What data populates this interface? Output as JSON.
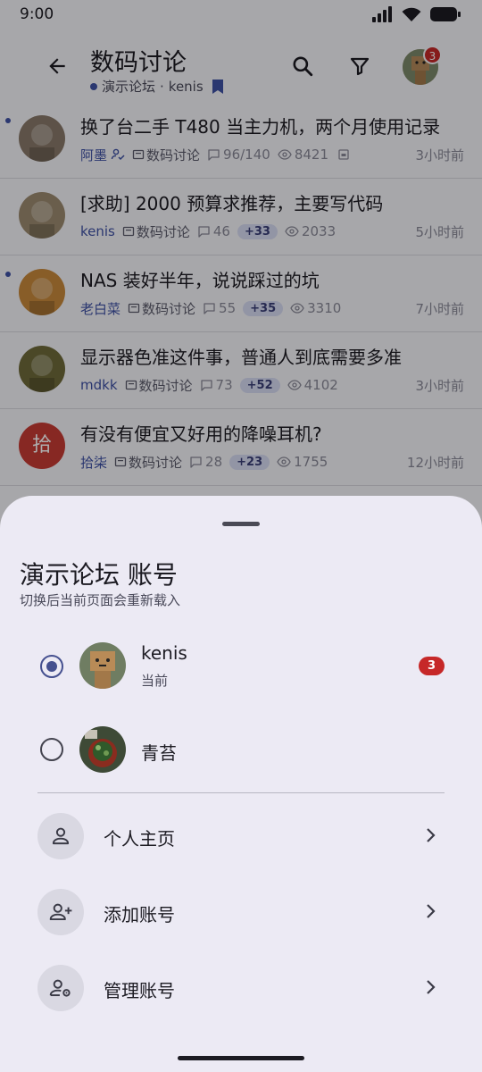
{
  "status_bar": {
    "time": "9:00"
  },
  "header": {
    "title": "数码讨论",
    "forum": "演示论坛",
    "separator": "·",
    "user": "kenis",
    "badge_count": "3"
  },
  "threads": [
    {
      "title": "换了台二手 T480 当主力机，两个月使用记录",
      "author": "阿墨",
      "forum": "数码讨论",
      "replies": "96/140",
      "new_count": "",
      "views": "8421",
      "time": "3小时前",
      "unread": true,
      "avatar_color": "#8a7a6a"
    },
    {
      "title": "[求助] 2000 预算求推荐，主要写代码",
      "author": "kenis",
      "forum": "数码讨论",
      "replies": "46",
      "new_count": "+33",
      "views": "2033",
      "time": "5小时前",
      "unread": false,
      "avatar_color": "#9c8b70"
    },
    {
      "title": "NAS 装好半年，说说踩过的坑",
      "author": "老白菜",
      "forum": "数码讨论",
      "replies": "55",
      "new_count": "+35",
      "views": "3310",
      "time": "7小时前",
      "unread": true,
      "avatar_color": "#c98a3c"
    },
    {
      "title": "显示器色准这件事，普通人到底需要多准",
      "author": "mdkk",
      "forum": "数码讨论",
      "replies": "73",
      "new_count": "+52",
      "views": "4102",
      "time": "3小时前",
      "unread": false,
      "avatar_color": "#6f6a3a"
    },
    {
      "title": "有没有便宜又好用的降噪耳机?",
      "author": "拾柒",
      "forum": "数码讨论",
      "replies": "28",
      "new_count": "+23",
      "views": "1755",
      "time": "12小时前",
      "unread": false,
      "avatar_letter": "拾",
      "avatar_color": "#c73b34"
    }
  ],
  "sheet": {
    "title": "演示论坛 账号",
    "subtitle": "切换后当前页面会重新载入",
    "accounts": [
      {
        "name": "kenis",
        "status": "当前",
        "badge": "3",
        "selected": true
      },
      {
        "name": "青苔",
        "status": "",
        "badge": "",
        "selected": false
      }
    ],
    "actions": [
      {
        "label": "个人主页",
        "icon": "person-icon"
      },
      {
        "label": "添加账号",
        "icon": "person-add-icon"
      },
      {
        "label": "管理账号",
        "icon": "manage-accounts-icon"
      }
    ]
  },
  "colors": {
    "accent": "#3f51a5",
    "badge": "#c62828",
    "scrim": "rgba(0,0,0,0.32)",
    "sheet_bg": "#eceaf4"
  }
}
